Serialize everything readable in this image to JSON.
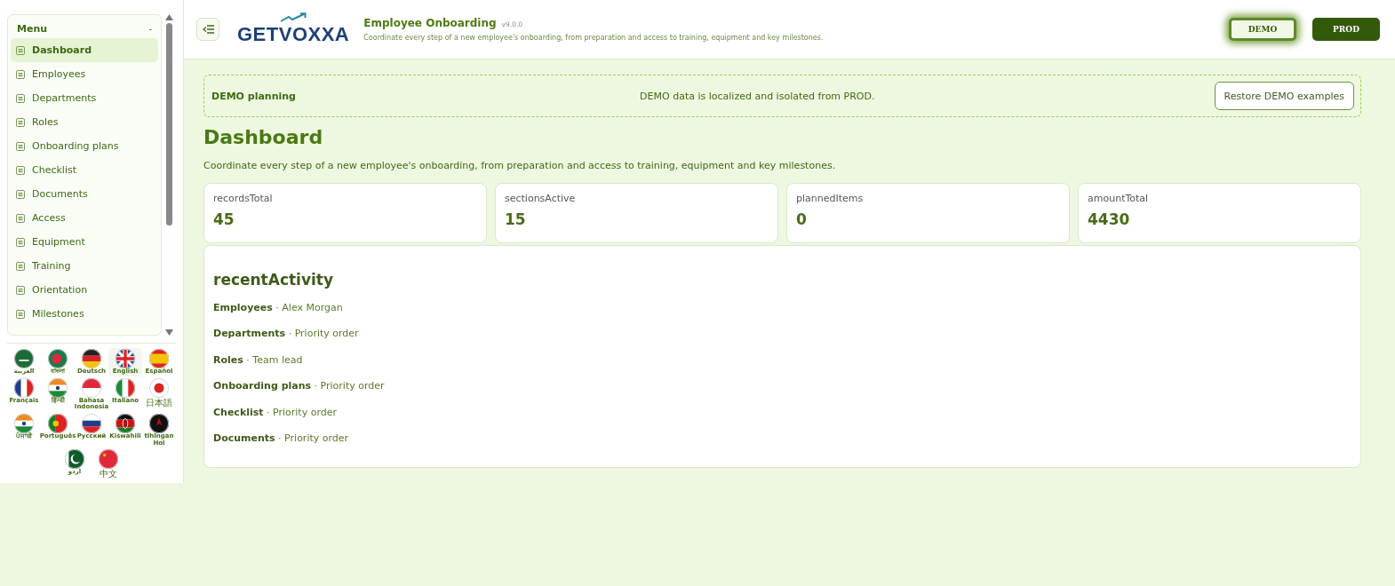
{
  "sidebar": {
    "menu_title": "Menu",
    "collapse_glyph": "-",
    "items": [
      {
        "label": "Dashboard",
        "selected": true
      },
      {
        "label": "Employees",
        "selected": false
      },
      {
        "label": "Departments",
        "selected": false
      },
      {
        "label": "Roles",
        "selected": false
      },
      {
        "label": "Onboarding plans",
        "selected": false
      },
      {
        "label": "Checklist",
        "selected": false
      },
      {
        "label": "Documents",
        "selected": false
      },
      {
        "label": "Access",
        "selected": false
      },
      {
        "label": "Equipment",
        "selected": false
      },
      {
        "label": "Training",
        "selected": false
      },
      {
        "label": "Orientation",
        "selected": false
      },
      {
        "label": "Milestones",
        "selected": false
      }
    ],
    "languages": [
      {
        "label": "العربية",
        "selected": false
      },
      {
        "label": "বাংলা",
        "selected": false
      },
      {
        "label": "Deutsch",
        "selected": false
      },
      {
        "label": "English",
        "selected": true
      },
      {
        "label": "Español",
        "selected": false
      },
      {
        "label": "Français",
        "selected": false
      },
      {
        "label": "हिन्दी",
        "selected": false
      },
      {
        "label": "Bahasa Indonesia",
        "selected": false
      },
      {
        "label": "Italiano",
        "selected": false
      },
      {
        "label": "日本語",
        "selected": false
      },
      {
        "label": "ਪੰਜਾਬੀ",
        "selected": false
      },
      {
        "label": "Português",
        "selected": false
      },
      {
        "label": "Русский",
        "selected": false
      },
      {
        "label": "Kiswahili",
        "selected": false
      },
      {
        "label": "tlhIngan Hol",
        "selected": false
      },
      {
        "label": "اردو",
        "selected": false
      },
      {
        "label": "中文",
        "selected": false
      }
    ]
  },
  "header": {
    "logo_text": "GETVOXXA",
    "title": "Employee Onboarding",
    "version": "v9.0.0",
    "subtitle": "Coordinate every step of a new employee's onboarding, from preparation and access to training, equipment and key milestones.",
    "environments": [
      {
        "label": "DEMO",
        "selected": true
      },
      {
        "label": "PROD",
        "selected": false
      }
    ]
  },
  "banner": {
    "title": "DEMO planning",
    "message": "DEMO data is localized and isolated from PROD.",
    "button": "Restore DEMO examples"
  },
  "page": {
    "title": "Dashboard",
    "description": "Coordinate every step of a new employee's onboarding, from preparation and access to training, equipment and key milestones."
  },
  "stats": [
    {
      "label": "recordsTotal",
      "value": "45"
    },
    {
      "label": "sectionsActive",
      "value": "15"
    },
    {
      "label": "plannedItems",
      "value": "0"
    },
    {
      "label": "amountTotal",
      "value": "4430"
    }
  ],
  "recent_activity": {
    "title": "recentActivity",
    "separator": "·",
    "items": [
      {
        "section": "Employees",
        "detail": "Alex Morgan"
      },
      {
        "section": "Departments",
        "detail": "Priority order"
      },
      {
        "section": "Roles",
        "detail": "Team lead"
      },
      {
        "section": "Onboarding plans",
        "detail": "Priority order"
      },
      {
        "section": "Checklist",
        "detail": "Priority order"
      },
      {
        "section": "Documents",
        "detail": "Priority order"
      }
    ]
  }
}
